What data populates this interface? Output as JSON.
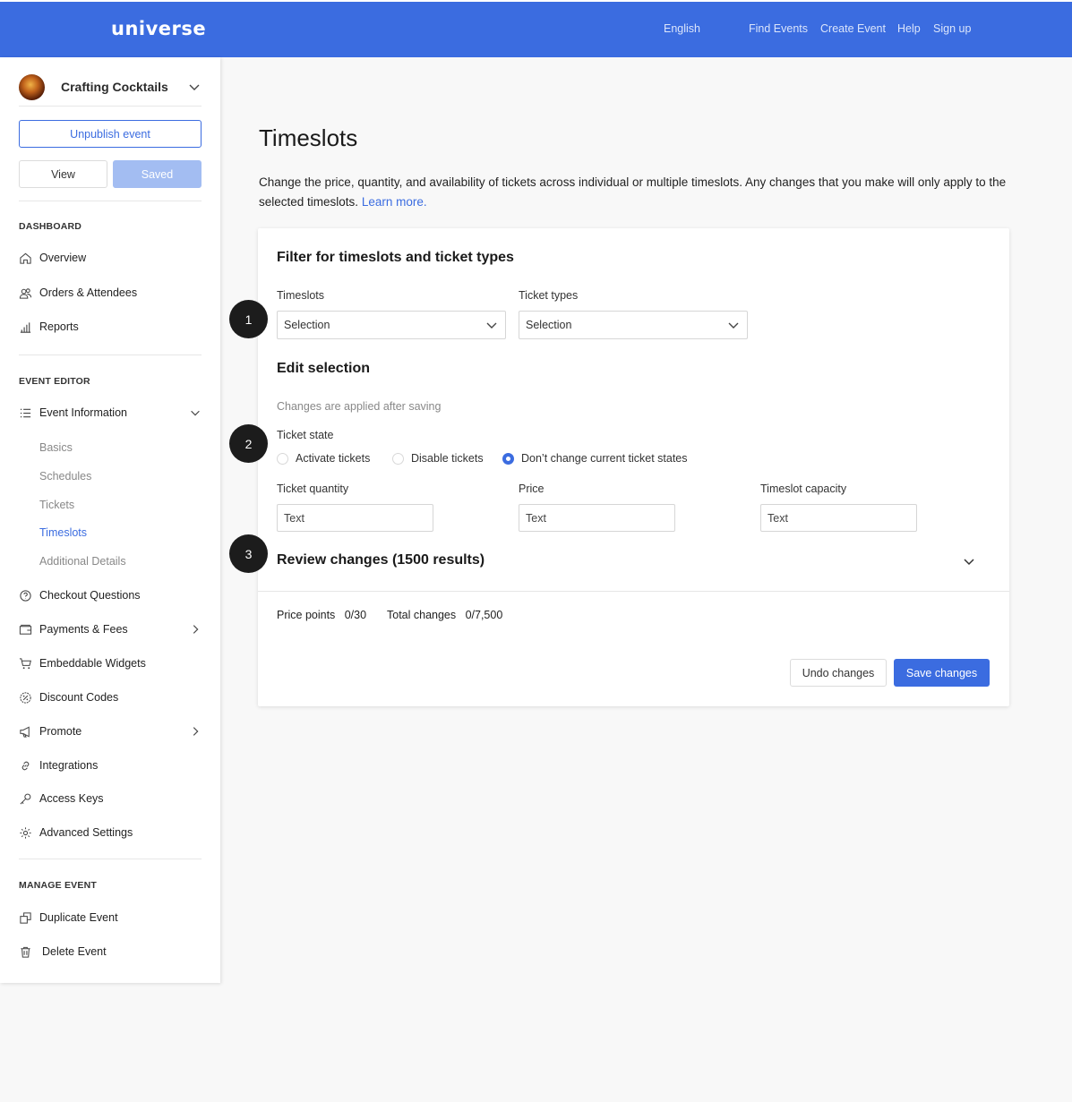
{
  "topbar": {
    "logo": "universe",
    "language": "English",
    "nav": [
      "Find Events",
      "Create Event",
      "Help",
      "Sign up"
    ],
    "color": "#3b6ce0"
  },
  "sidebar": {
    "event_name": "Crafting Cocktails",
    "unpublish_label": "Unpublish event",
    "view_label": "View",
    "saved_label": "Saved",
    "dashboard_label": "DASHBOARD",
    "dashboard_items": [
      {
        "label": "Overview",
        "icon": "home-icon"
      },
      {
        "label": "Orders & Attendees",
        "icon": "people-icon"
      },
      {
        "label": "Reports",
        "icon": "bar-chart-icon"
      }
    ],
    "editor_label": "EVENT EDITOR",
    "event_information": {
      "label": "Event Information",
      "icon": "list-icon"
    },
    "sub_items": [
      "Basics",
      "Schedules",
      "Tickets",
      "Timeslots",
      "Additional Details"
    ],
    "active_sub_item": "Timeslots",
    "editor_items": [
      {
        "label": "Checkout Questions",
        "icon": "question-icon"
      },
      {
        "label": "Payments & Fees",
        "icon": "wallet-icon"
      },
      {
        "label": "Embeddable Widgets",
        "icon": "cart-icon"
      },
      {
        "label": "Discount Codes",
        "icon": "discount-icon"
      },
      {
        "label": "Promote",
        "icon": "megaphone-icon"
      },
      {
        "label": "Integrations",
        "icon": "link-icon"
      },
      {
        "label": "Access Keys",
        "icon": "key-icon"
      },
      {
        "label": "Advanced Settings",
        "icon": "gear-icon"
      }
    ],
    "manage_label": "MANAGE EVENT",
    "manage_items": [
      {
        "label": "Duplicate Event",
        "icon": "duplicate-icon"
      },
      {
        "label": "Delete Event",
        "icon": "trash-icon"
      }
    ]
  },
  "main": {
    "title": "Timeslots",
    "intro": "Change the price, quantity, and availability of tickets across individual or multiple timeslots. Any changes that you make will only apply to the selected timeslots.",
    "learn_more": "Learn more.",
    "filter": {
      "heading": "Filter for timeslots and ticket types",
      "timeslots_label": "Timeslots",
      "timeslots_value": "Selection",
      "ticket_types_label": "Ticket types",
      "ticket_types_value": "Selection"
    },
    "edit": {
      "heading": "Edit selection",
      "hint": "Changes are applied after saving",
      "ticket_state_label": "Ticket state",
      "options": [
        "Activate tickets",
        "Disable tickets",
        "Don’t change current ticket states"
      ],
      "selected_option": "Don’t change current ticket states",
      "quantity_label": "Ticket quantity",
      "quantity_value": "Text",
      "price_label": "Price",
      "price_value": "Text",
      "capacity_label": "Timeslot capacity",
      "capacity_value": "Text"
    },
    "review": {
      "heading": "Review changes (1500 results)",
      "price_points_label": "Price points",
      "price_points_value": "0/30",
      "total_changes_label": "Total changes",
      "total_changes_value": "0/7,500",
      "undo_label": "Undo changes",
      "save_label": "Save changes"
    },
    "steps": [
      "1",
      "2",
      "3"
    ]
  }
}
